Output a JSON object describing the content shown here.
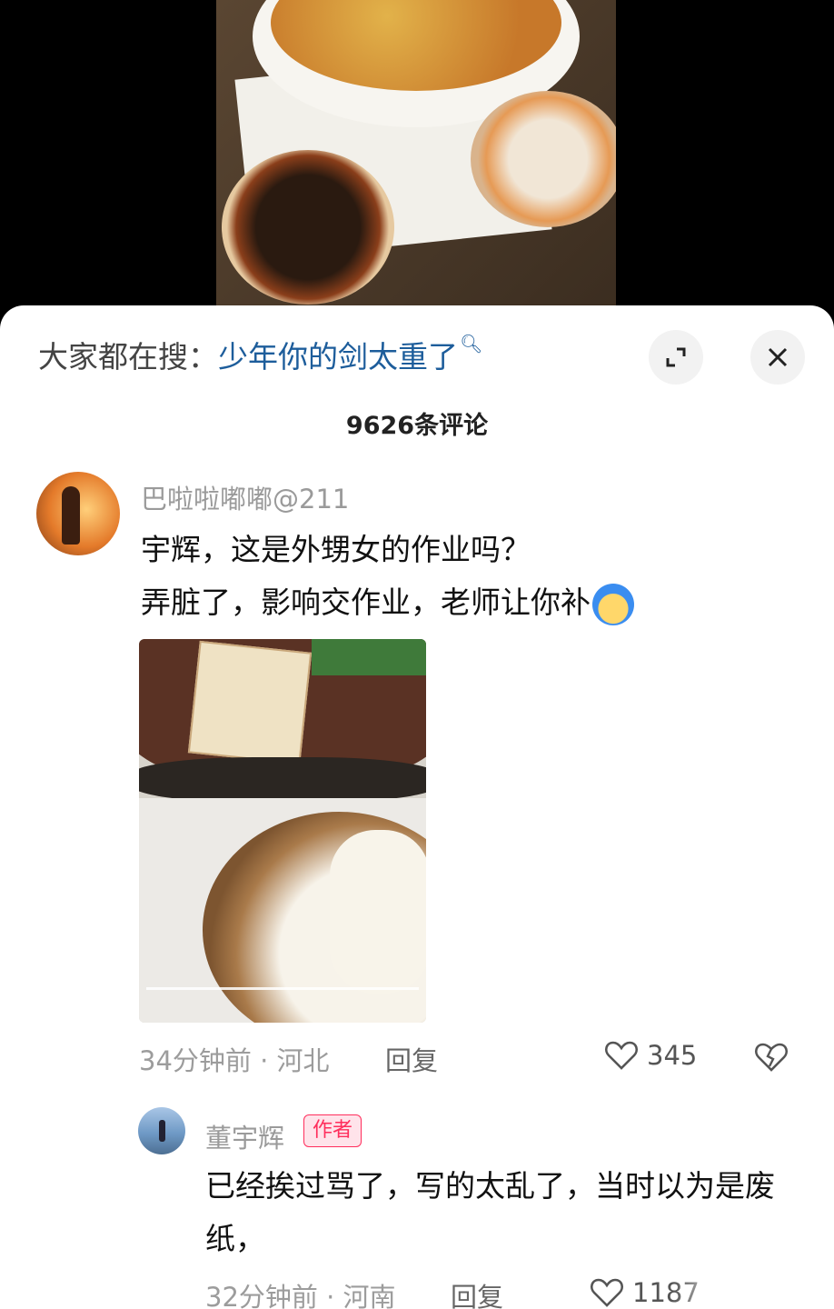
{
  "search": {
    "prefix": "大家都在搜：",
    "query": "少年你的剑太重了",
    "search_icon": "magnifier-icon"
  },
  "buttons": {
    "expand_icon": "expand-icon",
    "close_icon": "close-icon"
  },
  "comments_header": {
    "count_label": "9626条评论"
  },
  "comments": [
    {
      "username": "巴啦啦嘟嘟@211",
      "line1": "宇辉，这是外甥女的作业吗？",
      "line2": "弄脏了，影响交作业，老师让你补",
      "time_location": "34分钟前 · 河北",
      "reply_label": "回复",
      "likes": "345"
    },
    {
      "username": "董宇辉",
      "badge": "作者",
      "text": "已经挨过骂了，写的太乱了，当时以为是废纸，",
      "time_location": "32分钟前 · 河南",
      "reply_label": "回复",
      "likes": "1187"
    }
  ],
  "colors": {
    "query_link": "#1d5d9b",
    "author_badge": "#ff2e5c",
    "meta_gray": "#9c9c9c"
  }
}
